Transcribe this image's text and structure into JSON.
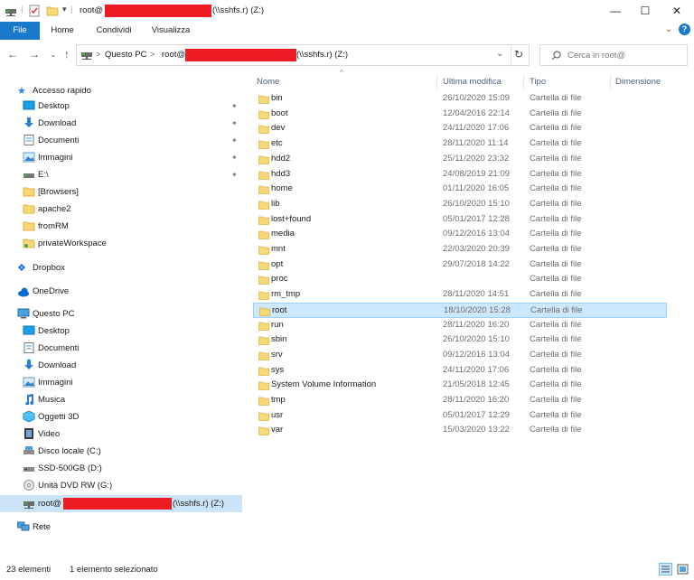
{
  "title": {
    "path_prefix": "root@",
    "path_suffix": "(\\\\sshfs.r) (Z:)",
    "minimize": "—",
    "maximize": "☐",
    "close": "✕"
  },
  "ribbon": {
    "tabs": [
      "File",
      "Home",
      "Condividi",
      "Visualizza"
    ]
  },
  "address": {
    "crumb_root": "Questo PC",
    "crumb_sep": ">",
    "crumb_prefix": "root@",
    "crumb_suffix": "(\\\\sshfs.r) (Z:)",
    "search_placeholder": "Cerca in root@"
  },
  "navigation": {
    "quick_access": "Accesso rapido",
    "quick_items": [
      "Desktop",
      "Download",
      "Documenti",
      "Immagini",
      "E:\\",
      "[Browsers]",
      "apache2",
      "fromRM",
      "privateWorkspace"
    ],
    "dropbox": "Dropbox",
    "onedrive": "OneDrive",
    "this_pc": "Questo PC",
    "pc_items": [
      "Desktop",
      "Documenti",
      "Download",
      "Immagini",
      "Musica",
      "Oggetti 3D",
      "Video",
      "Disco locale (C:)",
      "SSD-500GB (D:)",
      "Unità DVD RW (G:)"
    ],
    "selected_prefix": "root@",
    "selected_suffix": "(\\\\sshfs.r) (Z:)",
    "network": "Rete"
  },
  "columns": {
    "name": "Nome",
    "modified": "Ultima modifica",
    "type": "Tipo",
    "size": "Dimensione"
  },
  "files": [
    {
      "name": "bin",
      "date": "26/10/2020 15:09",
      "type": "Cartella di file"
    },
    {
      "name": "boot",
      "date": "12/04/2016 22:14",
      "type": "Cartella di file"
    },
    {
      "name": "dev",
      "date": "24/11/2020 17:06",
      "type": "Cartella di file"
    },
    {
      "name": "etc",
      "date": "28/11/2020 11:14",
      "type": "Cartella di file"
    },
    {
      "name": "hdd2",
      "date": "25/11/2020 23:32",
      "type": "Cartella di file"
    },
    {
      "name": "hdd3",
      "date": "24/08/2019 21:09",
      "type": "Cartella di file"
    },
    {
      "name": "home",
      "date": "01/11/2020 16:05",
      "type": "Cartella di file"
    },
    {
      "name": "lib",
      "date": "26/10/2020 15:10",
      "type": "Cartella di file"
    },
    {
      "name": "lost+found",
      "date": "05/01/2017 12:28",
      "type": "Cartella di file"
    },
    {
      "name": "media",
      "date": "09/12/2016 13:04",
      "type": "Cartella di file"
    },
    {
      "name": "mnt",
      "date": "22/03/2020 20:39",
      "type": "Cartella di file"
    },
    {
      "name": "opt",
      "date": "29/07/2018 14:22",
      "type": "Cartella di file"
    },
    {
      "name": "proc",
      "date": "",
      "type": "Cartella di file"
    },
    {
      "name": "rm_tmp",
      "date": "28/11/2020 14:51",
      "type": "Cartella di file"
    },
    {
      "name": "root",
      "date": "18/10/2020 15:28",
      "type": "Cartella di file"
    },
    {
      "name": "run",
      "date": "28/11/2020 16:20",
      "type": "Cartella di file"
    },
    {
      "name": "sbin",
      "date": "26/10/2020 15:10",
      "type": "Cartella di file"
    },
    {
      "name": "srv",
      "date": "09/12/2016 13:04",
      "type": "Cartella di file"
    },
    {
      "name": "sys",
      "date": "24/11/2020 17:06",
      "type": "Cartella di file"
    },
    {
      "name": "System Volume Information",
      "date": "21/05/2018 12:45",
      "type": "Cartella di file"
    },
    {
      "name": "tmp",
      "date": "28/11/2020 16:20",
      "type": "Cartella di file"
    },
    {
      "name": "usr",
      "date": "05/01/2017 12:29",
      "type": "Cartella di file"
    },
    {
      "name": "var",
      "date": "15/03/2020 13:22",
      "type": "Cartella di file"
    }
  ],
  "selected_file": "root",
  "status": {
    "count": "23 elementi",
    "selection": "1 elemento selezionato"
  },
  "colors": {
    "accent": "#1979ca",
    "selection_bg": "#cce8ff",
    "selection_border": "#99d1ff",
    "redaction": "#ed1c24",
    "folder": "#f8d775"
  }
}
